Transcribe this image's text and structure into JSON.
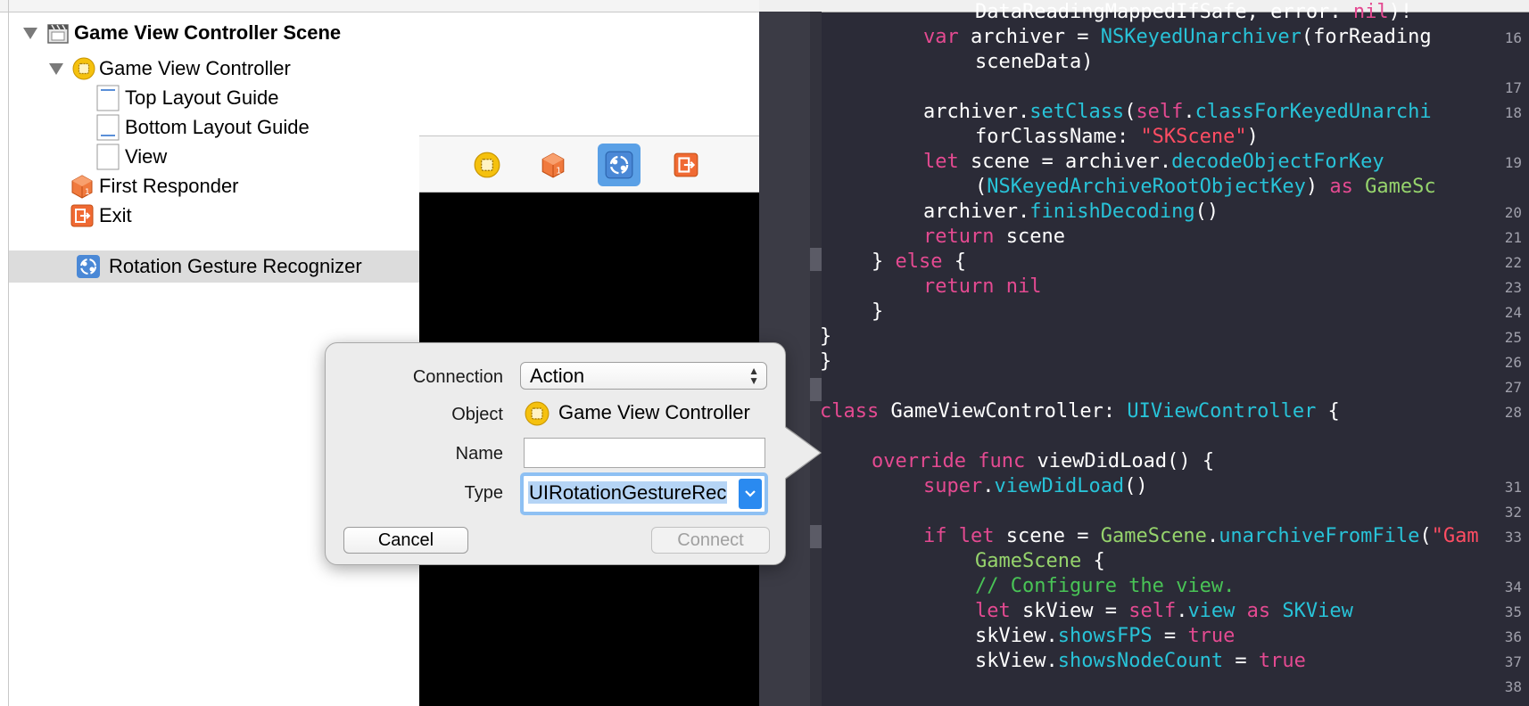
{
  "outline": {
    "items": [
      {
        "label": "Game View Controller Scene",
        "icon": "scene-icon"
      },
      {
        "label": "Game View Controller",
        "icon": "view-controller-icon"
      },
      {
        "label": "Top Layout Guide",
        "icon": "layout-guide-icon"
      },
      {
        "label": "Bottom Layout Guide",
        "icon": "layout-guide-icon"
      },
      {
        "label": "View",
        "icon": "view-icon"
      },
      {
        "label": "First Responder",
        "icon": "first-responder-icon"
      },
      {
        "label": "Exit",
        "icon": "exit-icon"
      },
      {
        "label": "Rotation Gesture Recognizer",
        "icon": "rotation-gesture-icon",
        "selected": true
      }
    ]
  },
  "scene_dock": {
    "icons": [
      "view-controller-icon",
      "first-responder-icon",
      "rotation-gesture-icon",
      "exit-icon"
    ],
    "selected": "rotation-gesture-icon"
  },
  "popover": {
    "connection_label": "Connection",
    "connection_value": "Action",
    "object_label": "Object",
    "object_value": "Game View Controller",
    "name_label": "Name",
    "name_value": "",
    "type_label": "Type",
    "type_value": "UIRotationGestureRec",
    "cancel_label": "Cancel",
    "connect_label": "Connect"
  },
  "editor": {
    "lines": [
      {
        "num": "",
        "text": "DataReadingMappedIfSafe, error: nil)!"
      },
      {
        "num": "16",
        "text": "var archiver = NSKeyedUnarchiver(forReading"
      },
      {
        "num": "",
        "text": "sceneData)"
      },
      {
        "num": "17",
        "text": ""
      },
      {
        "num": "18",
        "text": "archiver.setClass(self.classForKeyedUnarchi"
      },
      {
        "num": "",
        "text": "forClassName: \"SKScene\")"
      },
      {
        "num": "19",
        "text": "let scene = archiver.decodeObjectForKey"
      },
      {
        "num": "",
        "text": "(NSKeyedArchiveRootObjectKey) as GameSc"
      },
      {
        "num": "20",
        "text": "archiver.finishDecoding()"
      },
      {
        "num": "21",
        "text": "return scene"
      },
      {
        "num": "22",
        "text": "} else {"
      },
      {
        "num": "23",
        "text": "return nil"
      },
      {
        "num": "24",
        "text": "}"
      },
      {
        "num": "25",
        "text": "}"
      },
      {
        "num": "26",
        "text": "}"
      },
      {
        "num": "27",
        "text": ""
      },
      {
        "num": "28",
        "text": "class GameViewController: UIViewController {"
      },
      {
        "num": "",
        "text": ""
      },
      {
        "num": "",
        "text": "override func viewDidLoad() {"
      },
      {
        "num": "31",
        "text": "super.viewDidLoad()"
      },
      {
        "num": "32",
        "text": ""
      },
      {
        "num": "33",
        "text": "if let scene = GameScene.unarchiveFromFile(\"Gam"
      },
      {
        "num": "",
        "text": "GameScene {"
      },
      {
        "num": "34",
        "text": "// Configure the view."
      },
      {
        "num": "35",
        "text": "let skView = self.view as SKView"
      },
      {
        "num": "36",
        "text": "skView.showsFPS = true"
      },
      {
        "num": "37",
        "text": "skView.showsNodeCount = true"
      },
      {
        "num": "38",
        "text": ""
      }
    ]
  },
  "colors": {
    "editor_background": "#2b2b37",
    "keyword": "#e44a91",
    "type": "#28c3d8",
    "class_name": "#96d46c",
    "string": "#ff4d63",
    "comment": "#49c456",
    "selection": "#5aa0e6"
  }
}
